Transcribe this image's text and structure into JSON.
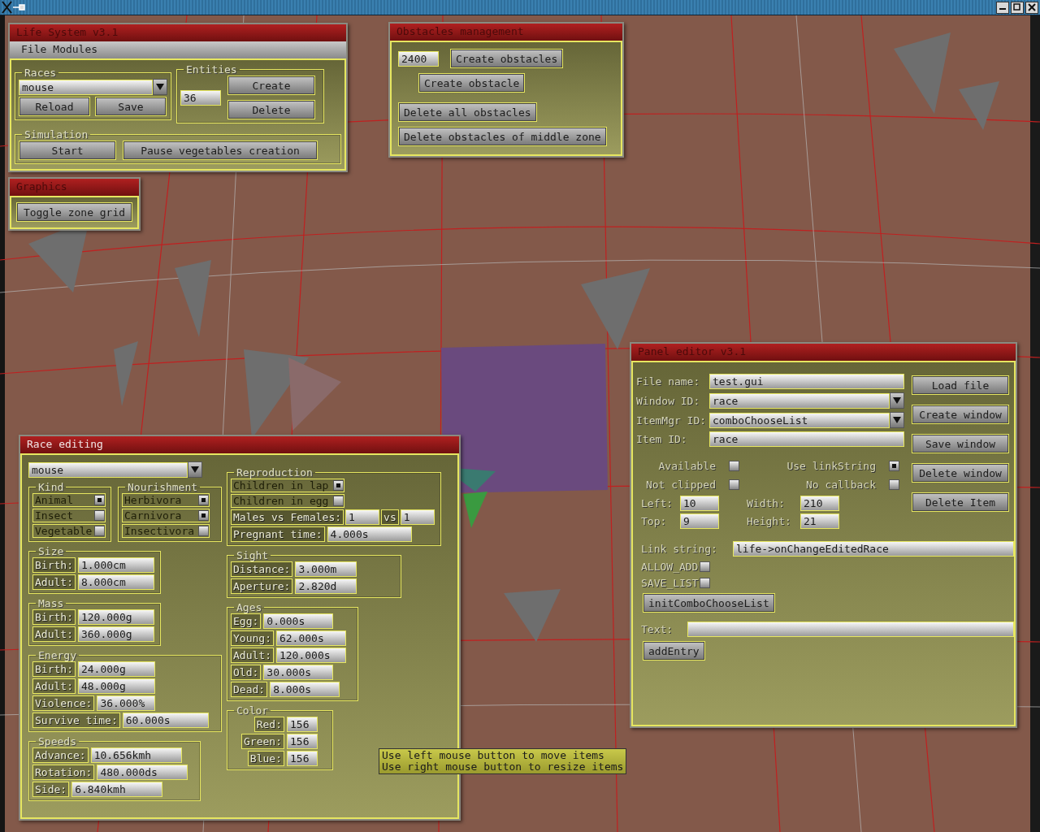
{
  "life_system": {
    "title": "Life System v3.1",
    "active": false,
    "menu": [
      {
        "label": "File"
      },
      {
        "label": "Modules"
      }
    ],
    "races": {
      "legend": "Races",
      "value": "mouse",
      "buttons": [
        "Reload",
        "Save"
      ]
    },
    "entities": {
      "legend": "Entities",
      "count": "36",
      "buttons": [
        "Create",
        "Delete"
      ]
    },
    "simulation": {
      "legend": "Simulation",
      "buttons": [
        "Start",
        "Pause vegetables creation"
      ]
    }
  },
  "graphics": {
    "title": "Graphics",
    "active": false,
    "buttons": [
      "Toggle zone grid"
    ]
  },
  "obstacles": {
    "title": "Obstacles management",
    "active": false,
    "count": "2400",
    "buttons": [
      "Create obstacles",
      "Create obstacle",
      "Delete all obstacles",
      "Delete obstacles of middle zone"
    ]
  },
  "race_editing": {
    "title": "Race editing",
    "active": true,
    "race": "mouse",
    "kind": {
      "legend": "Kind",
      "options": [
        {
          "label": "Animal",
          "checked": true
        },
        {
          "label": "Insect",
          "checked": false
        },
        {
          "label": "Vegetable",
          "checked": false
        }
      ]
    },
    "nourishment": {
      "legend": "Nourishment",
      "options": [
        {
          "label": "Herbivora",
          "checked": true
        },
        {
          "label": "Carnivora",
          "checked": true
        },
        {
          "label": "Insectivora",
          "checked": false
        }
      ]
    },
    "size": {
      "legend": "Size",
      "fields": [
        {
          "label": "Birth:",
          "value": "1.000cm"
        },
        {
          "label": "Adult:",
          "value": "8.000cm"
        }
      ]
    },
    "mass": {
      "legend": "Mass",
      "fields": [
        {
          "label": "Birth:",
          "value": "120.000g"
        },
        {
          "label": "Adult:",
          "value": "360.000g"
        }
      ]
    },
    "energy": {
      "legend": "Energy",
      "fields": [
        {
          "label": "Birth:",
          "value": "24.000g"
        },
        {
          "label": "Adult:",
          "value": "48.000g"
        },
        {
          "label": "Violence:",
          "value": "36.000%"
        },
        {
          "label": "Survive time:",
          "value": "60.000s"
        }
      ]
    },
    "speeds": {
      "legend": "Speeds",
      "fields": [
        {
          "label": "Advance:",
          "value": "10.656kmh"
        },
        {
          "label": "Rotation:",
          "value": "480.000ds"
        },
        {
          "label": "Side:",
          "value": "6.840kmh"
        }
      ]
    },
    "reproduction": {
      "legend": "Reproduction",
      "options": [
        {
          "label": "Children in lap",
          "checked": true
        },
        {
          "label": "Children in egg",
          "checked": false
        }
      ],
      "ratio": {
        "label": "Males vs Females:",
        "males": "1",
        "vs": "vs",
        "females": "1"
      },
      "fields": [
        {
          "label": "Pregnant time:",
          "value": "4.000s"
        }
      ]
    },
    "sight": {
      "legend": "Sight",
      "fields": [
        {
          "label": "Distance:",
          "value": "3.000m"
        },
        {
          "label": "Aperture:",
          "value": "2.820d"
        }
      ]
    },
    "ages": {
      "legend": "Ages",
      "fields": [
        {
          "label": "Egg:",
          "value": "0.000s"
        },
        {
          "label": "Young:",
          "value": "62.000s"
        },
        {
          "label": "Adult:",
          "value": "120.000s"
        },
        {
          "label": "Old:",
          "value": "30.000s"
        },
        {
          "label": "Dead:",
          "value": "8.000s"
        }
      ]
    },
    "color": {
      "legend": "Color",
      "fields": [
        {
          "label": "Red:",
          "value": "156"
        },
        {
          "label": "Green:",
          "value": "156"
        },
        {
          "label": "Blue:",
          "value": "156"
        }
      ]
    }
  },
  "panel_editor": {
    "title": "Panel editor v3.1",
    "active": false,
    "fields": [
      {
        "label": "File name:",
        "value": "test.gui",
        "dropdown": false
      },
      {
        "label": "Window ID:",
        "value": "race",
        "dropdown": true
      },
      {
        "label": "ItemMgr ID:",
        "value": "comboChooseList",
        "dropdown": true
      },
      {
        "label": "Item ID:",
        "value": "race",
        "dropdown": false
      }
    ],
    "buttons": [
      "Load file",
      "Create window",
      "Save window",
      "Delete window",
      "Delete Item"
    ],
    "flags": [
      {
        "label": "Available",
        "checked": false
      },
      {
        "label": "Use linkString",
        "checked": true
      },
      {
        "label": "Not clipped",
        "checked": false
      },
      {
        "label": "No callback",
        "checked": false
      }
    ],
    "geometry": [
      {
        "label": "Left:",
        "value": "10"
      },
      {
        "label": "Width:",
        "value": "210"
      },
      {
        "label": "Top:",
        "value": "9"
      },
      {
        "label": "Height:",
        "value": "21"
      }
    ],
    "link": {
      "label": "Link string:",
      "value": "life->onChangeEditedRace"
    },
    "list_flags": [
      {
        "label": "ALLOW_ADD",
        "checked": false
      },
      {
        "label": "SAVE_LIST",
        "checked": false
      }
    ],
    "init_button": "initComboChooseList",
    "text_label": "Text:",
    "add_button": "addEntry"
  },
  "tooltip": {
    "lines": [
      "Use left mouse button to move items",
      "Use right mouse button to resize items"
    ]
  }
}
